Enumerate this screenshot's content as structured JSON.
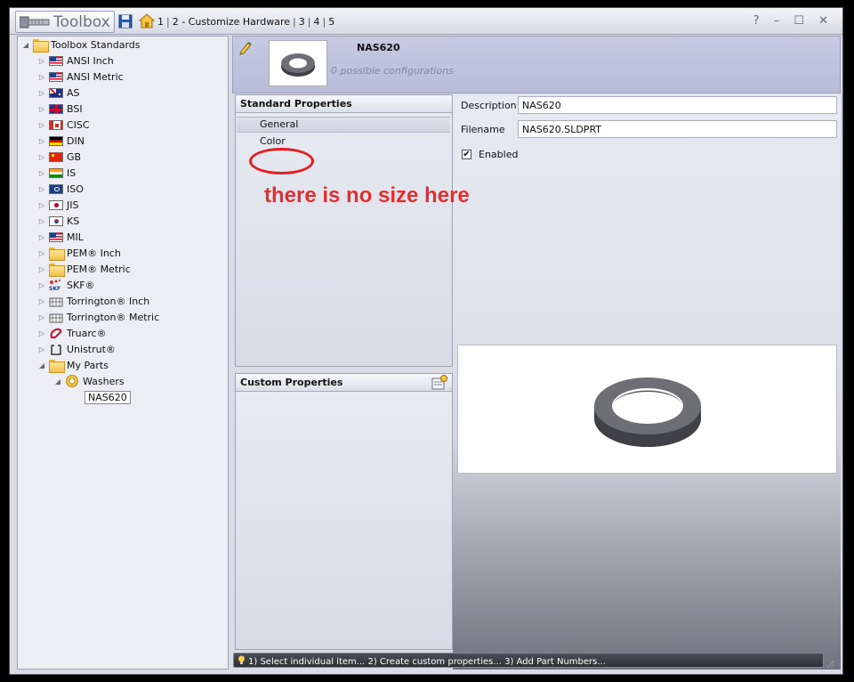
{
  "app": {
    "title": "Toolbox",
    "window_controls": "? – ☐ ✕"
  },
  "breadcrumb": {
    "items": [
      "1",
      "2 - Customize Hardware",
      "3",
      "4",
      "5"
    ]
  },
  "tree": {
    "items": [
      {
        "label": "Toolbox Standards",
        "icon": "folder-icon",
        "level": 0,
        "expanded": true
      },
      {
        "label": "ANSI Inch",
        "icon": "usa-flag-icon",
        "level": 1
      },
      {
        "label": "ANSI Metric",
        "icon": "usa-flag-icon",
        "level": 1
      },
      {
        "label": "AS",
        "icon": "australia-flag-icon",
        "level": 1
      },
      {
        "label": "BSI",
        "icon": "uk-flag-icon",
        "level": 1
      },
      {
        "label": "CISC",
        "icon": "canada-flag-icon",
        "level": 1
      },
      {
        "label": "DIN",
        "icon": "germany-flag-icon",
        "level": 1
      },
      {
        "label": "GB",
        "icon": "china-flag-icon",
        "level": 1
      },
      {
        "label": "IS",
        "icon": "india-flag-icon",
        "level": 1
      },
      {
        "label": "ISO",
        "icon": "iso-flag-icon",
        "level": 1
      },
      {
        "label": "JIS",
        "icon": "japan-flag-icon",
        "level": 1
      },
      {
        "label": "KS",
        "icon": "korea-flag-icon",
        "level": 1
      },
      {
        "label": "MIL",
        "icon": "usa-flag-icon",
        "level": 1
      },
      {
        "label": "PEM® Inch",
        "icon": "folder-icon",
        "level": 1
      },
      {
        "label": "PEM® Metric",
        "icon": "folder-icon",
        "level": 1
      },
      {
        "label": "SKF®",
        "icon": "skf-logo-icon",
        "level": 1
      },
      {
        "label": "Torrington® Inch",
        "icon": "torrington-icon",
        "level": 1
      },
      {
        "label": "Torrington® Metric",
        "icon": "torrington-icon",
        "level": 1
      },
      {
        "label": "Truarc®",
        "icon": "truarc-icon",
        "level": 1
      },
      {
        "label": "Unistrut®",
        "icon": "unistrut-icon",
        "level": 1
      },
      {
        "label": "My Parts",
        "icon": "folder-icon",
        "level": 1,
        "expanded": true
      },
      {
        "label": "Washers",
        "icon": "washer-icon",
        "level": 2,
        "expanded": true
      },
      {
        "label": "NAS620",
        "icon": "",
        "level": 3,
        "selected": true
      }
    ]
  },
  "header": {
    "part_name": "NAS620",
    "configurations": "0 possible configurations"
  },
  "standard_properties": {
    "title": "Standard Properties",
    "items": [
      "General",
      "Color"
    ]
  },
  "custom_properties": {
    "title": "Custom Properties"
  },
  "fields": {
    "description_label": "Description",
    "description_value": "NAS620",
    "filename_label": "Filename",
    "filename_value": "NAS620.SLDPRT",
    "enabled_label": "Enabled",
    "enabled_checked": true
  },
  "annotation": {
    "text": "there is no size here",
    "color": "#e03030"
  },
  "status": {
    "text": "1) Select individual item... 2) Create custom properties... 3) Add Part Numbers..."
  }
}
